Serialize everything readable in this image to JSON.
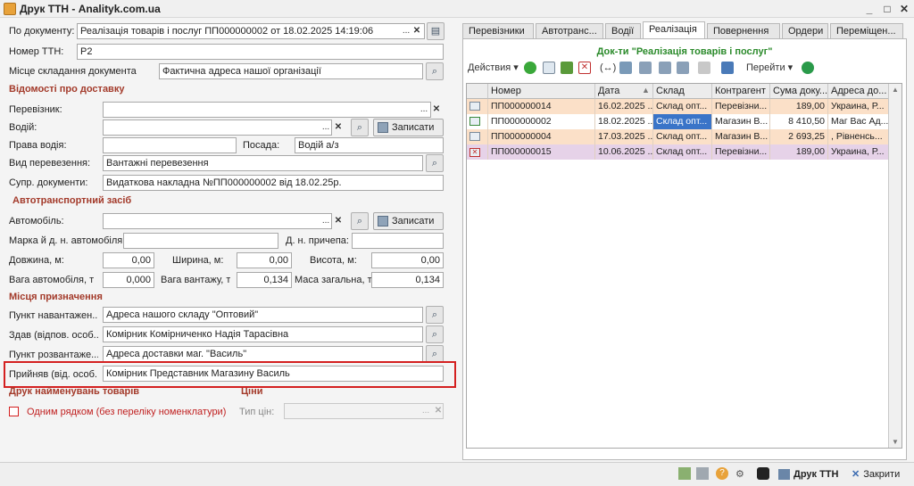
{
  "window": {
    "title": "Друк ТТН - Analityk.com.ua",
    "btn_min": "_",
    "btn_max": "□",
    "btn_close": "✕"
  },
  "form": {
    "po_doc_label": "По документу:",
    "po_doc_value": "Реалізація товарів і послуг ПП000000002 от 18.02.2025 14:19:06",
    "ttn_label": "Номер ТТН:",
    "ttn_value": "Р2",
    "place_label": "Місце складання документа",
    "place_value": "Фактична адреса нашої організації",
    "delivery_section": "Відомості про доставку",
    "carrier_label": "Перевізник:",
    "carrier_value": "",
    "driver_label": "Водій:",
    "driver_value": "",
    "save_label": "Записати",
    "license_label": "Права водія:",
    "license_value": "",
    "position_label": "Посада:",
    "position_value": "Водій а/з",
    "transport_type_label": "Вид перевезення:",
    "transport_type_value": "Вантажні перевезення",
    "accomp_label": "Супр. документи:",
    "accomp_value": "Видаткова накладна №ПП000000002 від 18.02.25р.",
    "vehicle_section": "Автотранспортний засіб",
    "car_label": "Автомобіль:",
    "car_value": "",
    "car_model_label": "Марка й д. н. автомобіля:",
    "car_model_value": "",
    "trailer_label": "Д. н. причепа:",
    "trailer_value": "",
    "length_label": "Довжина, м:",
    "length_value": "0,00",
    "width_label": "Ширина, м:",
    "width_value": "0,00",
    "height_label": "Висота, м:",
    "height_value": "0,00",
    "car_weight_label": "Вага автомобіля, т",
    "car_weight_value": "0,000",
    "cargo_weight_label": "Вага вантажу, т",
    "cargo_weight_value": "0,134",
    "total_weight_label": "Маса загальна, т:",
    "total_weight_value": "0,134",
    "dest_section": "Місця призначення",
    "load_point_label": "Пункт навантажен...",
    "load_point_value": "Адреса нашого складу \"Оптовий\"",
    "handed_label": "Здав (відпов. особ...",
    "handed_value": "Комірник Комірниченко Надія Тарасівна",
    "unload_point_label": "Пункт розвантаже...",
    "unload_point_value": "Адреса доставки маг. \"Василь\"",
    "received_label": "Прийняв (від. особ...",
    "received_value": "Комірник Представник Магазину Василь",
    "print_names_section": "Друк найменувань товарів",
    "one_line_label": "Одним рядком (без переліку номенклатури)",
    "prices_section": "Ціни",
    "price_type_label": "Тип цін:",
    "price_type_value": ""
  },
  "tabs": [
    "Перевізники",
    "Автотранс...",
    "Водії",
    "Реалізація",
    "Повернення",
    "Ордери",
    "Переміщен..."
  ],
  "panel": {
    "title": "Док-ти \"Реалізація товарів і послуг\"",
    "actions_label": "Действия ▾",
    "goto_label": "Перейти ▾",
    "columns": [
      "Номер",
      "Дата",
      "Склад",
      "Контрагент",
      "Сума доку...",
      "Адреса до..."
    ],
    "rows": [
      {
        "num": "ПП000000014",
        "date": "16.02.2025 ...",
        "store": "Склад опт...",
        "partner": "Перевізни...",
        "sum": "189,00",
        "addr": "Украина, Р..."
      },
      {
        "num": "ПП000000002",
        "date": "18.02.2025 ...",
        "store": "Склад опт...",
        "partner": "Магазин В...",
        "sum": "8 410,50",
        "addr": "Маг Вас Ад..."
      },
      {
        "num": "ПП000000004",
        "date": "17.03.2025 ...",
        "store": "Склад опт...",
        "partner": "Магазин В...",
        "sum": "2 693,25",
        "addr": ", Рівненсь..."
      },
      {
        "num": "ПП000000015",
        "date": "10.06.2025 ...",
        "store": "Склад опт...",
        "partner": "Перевізни...",
        "sum": "189,00",
        "addr": "Украина, Р..."
      }
    ]
  },
  "statusbar": {
    "print_label": "Друк ТТН",
    "close_label": "Закрити"
  },
  "colors": {
    "row_orange": "#fbe0c8",
    "row_purple": "#e6d2e8",
    "row_white": "#ffffff",
    "selected_cell": "#3a74c8",
    "highlight_border": "#d42020",
    "section": "#a33a2a"
  }
}
